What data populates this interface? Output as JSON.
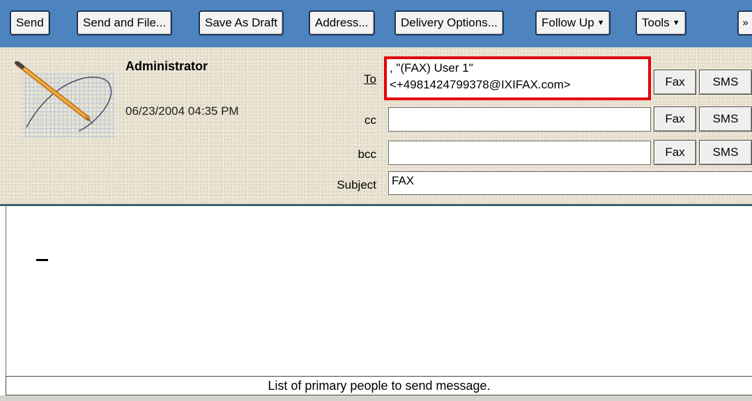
{
  "toolbar": {
    "buttons": [
      {
        "label": "Send"
      },
      {
        "label": "Send and File..."
      },
      {
        "label": "Save As Draft"
      },
      {
        "label": "Address..."
      },
      {
        "label": "Delivery Options..."
      },
      {
        "label": "Follow Up",
        "dropdown": true
      },
      {
        "label": "Tools",
        "dropdown": true
      }
    ],
    "more_icon": "double-chevron-down-icon",
    "background": "#4d83bf"
  },
  "header": {
    "from_name": "Administrator",
    "date_time": "06/23/2004 04:35 PM",
    "logo_icon": "pen-on-grid-icon"
  },
  "fields": {
    "to_label": "To",
    "to_value": ", \"(FAX) User 1\"<+4981424799378@IXIFAX.com>",
    "cc_label": "cc",
    "cc_value": "",
    "bcc_label": "bcc",
    "bcc_value": "",
    "subject_label": "Subject",
    "subject_value": "FAX"
  },
  "row_buttons": {
    "fax_label": "Fax",
    "sms_label": "SMS"
  },
  "status_text": "List of primary people to send message.",
  "colors": {
    "highlight_border": "#e3000f",
    "header_rule": "#3f6269"
  }
}
